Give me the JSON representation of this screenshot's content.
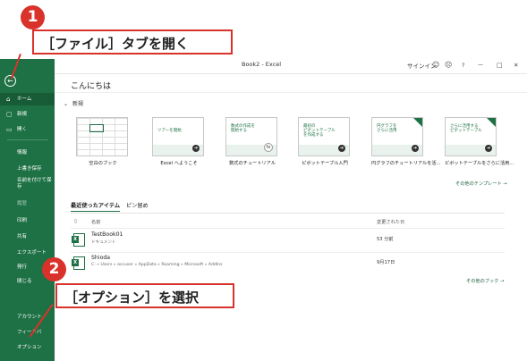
{
  "callouts": [
    {
      "number": "1",
      "text": "［ファイル］タブを開く"
    },
    {
      "number": "2",
      "text": "［オプション］を選択"
    }
  ],
  "window": {
    "title": "Book2  -  Excel",
    "signin": "サインイン",
    "controls": [
      "emoji-smile-icon",
      "emoji-frown-icon",
      "help-icon",
      "minimize-icon",
      "maximize-icon",
      "close-icon"
    ],
    "help_glyph": "?",
    "minimize_glyph": "—",
    "maximize_glyph": "□",
    "close_glyph": "✕"
  },
  "sidebar": {
    "back_glyph": "←",
    "items": [
      {
        "label": "ホーム",
        "icon": "home-icon",
        "glyph": "⌂",
        "active": true
      },
      {
        "label": "新規",
        "icon": "new-file-icon",
        "glyph": "▢"
      },
      {
        "label": "開く",
        "icon": "folder-open-icon",
        "glyph": "▭"
      },
      {
        "label": "情報"
      },
      {
        "label": "上書き保存"
      },
      {
        "label": "名前を付けて保\n存"
      },
      {
        "label": "履歴",
        "disabled": true
      },
      {
        "label": "印刷"
      },
      {
        "label": "共有"
      },
      {
        "label": "エクスポート"
      },
      {
        "label": "発行"
      },
      {
        "label": "閉じる"
      },
      {
        "label": "アカウント"
      },
      {
        "label": "フィードバ"
      },
      {
        "label": "オプション"
      }
    ]
  },
  "main": {
    "greeting": "こんにちは",
    "new_section": "新規",
    "templates": [
      {
        "label": "空白のブック",
        "thumb_text": ""
      },
      {
        "label": "Excel へようこそ",
        "thumb_text": "ツアーを開始"
      },
      {
        "label": "数式のチュートリアル",
        "thumb_text": "数式の作成を\n開始する"
      },
      {
        "label": "ピボットテーブル入門",
        "thumb_text": "最初の\nピボットテーブル\nを作成する"
      },
      {
        "label": "円グラフのチュートリアルを活...",
        "thumb_text": "円グラフを\nさらに活用"
      },
      {
        "label": "ピボットテーブルをさらに活用...",
        "thumb_text": "さらに活用する\nピボットテーブル"
      }
    ],
    "more_templates": "その他のテンプレート →",
    "tabs": [
      "最近使ったアイテム",
      "ピン留め"
    ],
    "columns": {
      "name": "名前",
      "date": "変更された日"
    },
    "files": [
      {
        "name": "TestBook01",
        "path": "ドキュメント",
        "date": "53 分前"
      },
      {
        "name": "Shioda",
        "path": "C: » Users » accuser » AppData » Roaming » Microsoft » AddIns",
        "date": "9月17日"
      }
    ],
    "more_books": "その他のブック →"
  },
  "colors": {
    "accent": "#1e7145",
    "callout": "#d9322a"
  }
}
